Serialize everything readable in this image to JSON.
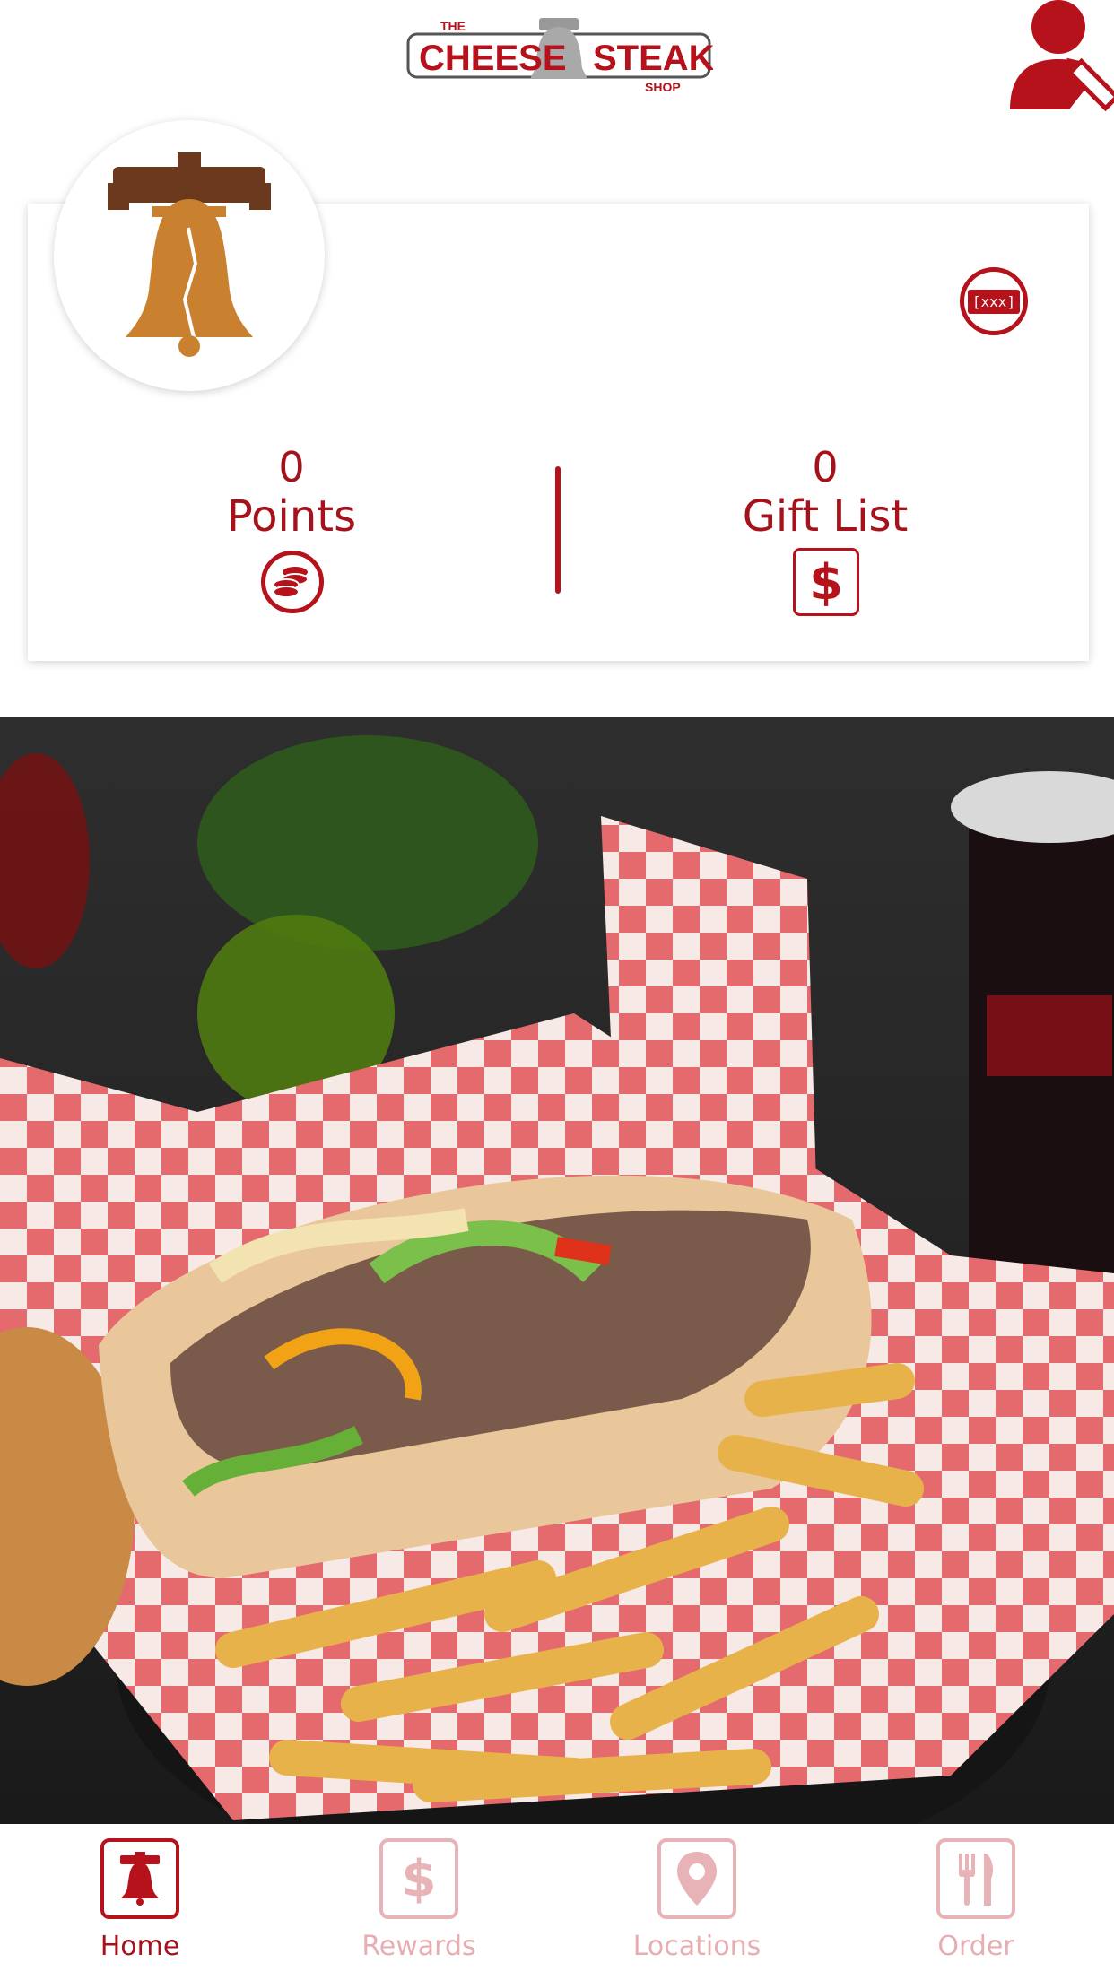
{
  "header": {
    "logo": {
      "line1": "THE",
      "line2a": "CHEESE",
      "line2b": "STEAK",
      "line3": "SHOP"
    },
    "profile_icon": "user-edit-icon"
  },
  "card": {
    "avatar_icon": "liberty-bell-icon",
    "barcode_label": "[xxx]",
    "points": {
      "value": "0",
      "label": "Points",
      "icon": "coins-icon"
    },
    "gift": {
      "value": "0",
      "label": "Gift List",
      "icon": "dollar-icon",
      "icon_glyph": "$"
    }
  },
  "hero": {
    "image": "cheesesteak-and-fries-photo"
  },
  "tabs": [
    {
      "label": "Home",
      "icon": "liberty-bell-icon",
      "active": true
    },
    {
      "label": "Rewards",
      "icon": "dollar-icon",
      "glyph": "$",
      "active": false
    },
    {
      "label": "Locations",
      "icon": "map-pin-icon",
      "active": false
    },
    {
      "label": "Order",
      "icon": "fork-knife-icon",
      "active": false
    }
  ],
  "colors": {
    "brand": "#b5121b",
    "brand_light": "#e8b3b6",
    "bell": "#c9812f",
    "bell_top": "#6b3a1e"
  }
}
